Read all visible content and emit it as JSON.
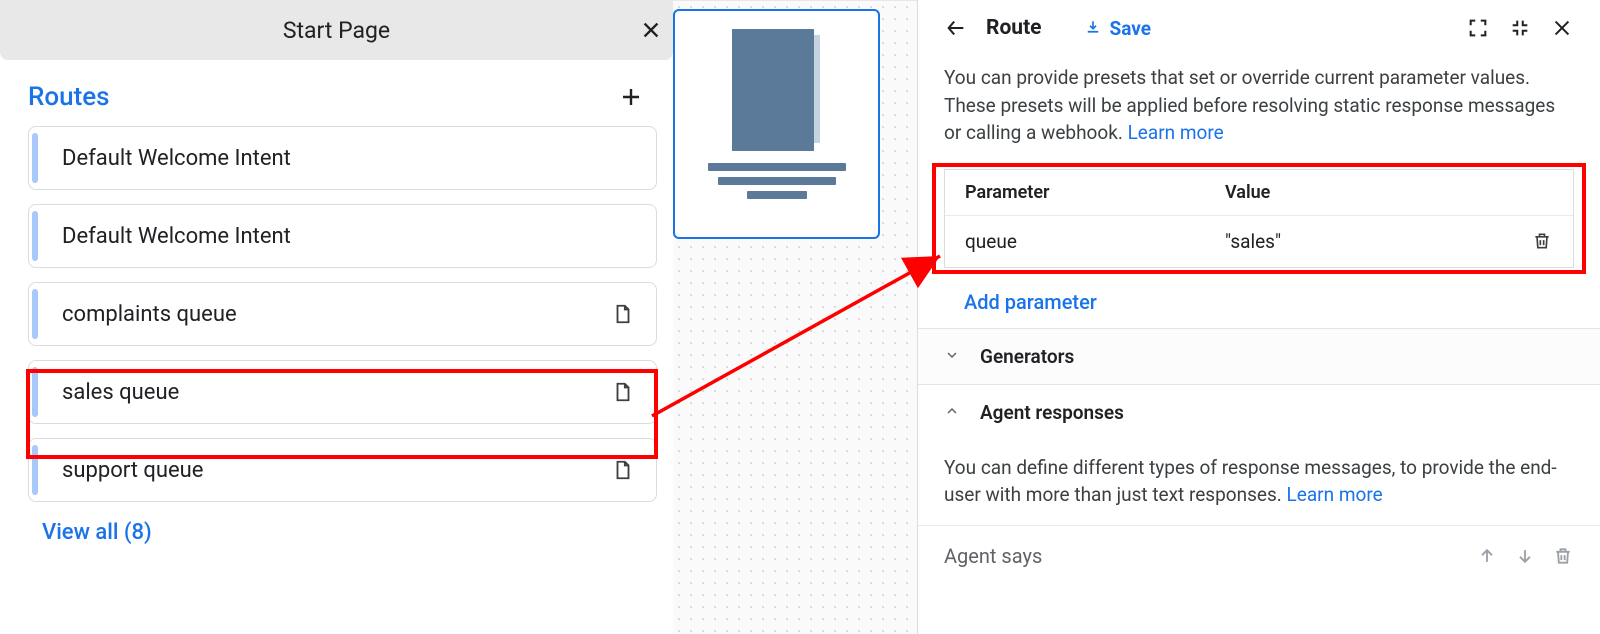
{
  "left": {
    "header_title": "Start Page",
    "routes_title": "Routes",
    "items": [
      {
        "label": "Default Welcome Intent",
        "has_page_icon": false,
        "highlight": false
      },
      {
        "label": "Default Welcome Intent",
        "has_page_icon": false,
        "highlight": false
      },
      {
        "label": "complaints queue",
        "has_page_icon": true,
        "highlight": false
      },
      {
        "label": "sales queue",
        "has_page_icon": true,
        "highlight": true
      },
      {
        "label": "support queue",
        "has_page_icon": true,
        "highlight": false
      }
    ],
    "view_all_label": "View all (8)"
  },
  "right": {
    "title": "Route",
    "save_label": "Save",
    "presets_desc": "You can provide presets that set or override current parameter values. These presets will be applied before resolving static response messages or calling a webhook. ",
    "learn_more": "Learn more",
    "param_table": {
      "header_param": "Parameter",
      "header_value": "Value",
      "rows": [
        {
          "param": "queue",
          "value": "\"sales\""
        }
      ]
    },
    "add_parameter_label": "Add parameter",
    "generators_title": "Generators",
    "agent_responses_title": "Agent responses",
    "agent_desc": "You can define different types of response messages, to provide the end-user with more than just text responses. ",
    "agent_says_label": "Agent says"
  }
}
